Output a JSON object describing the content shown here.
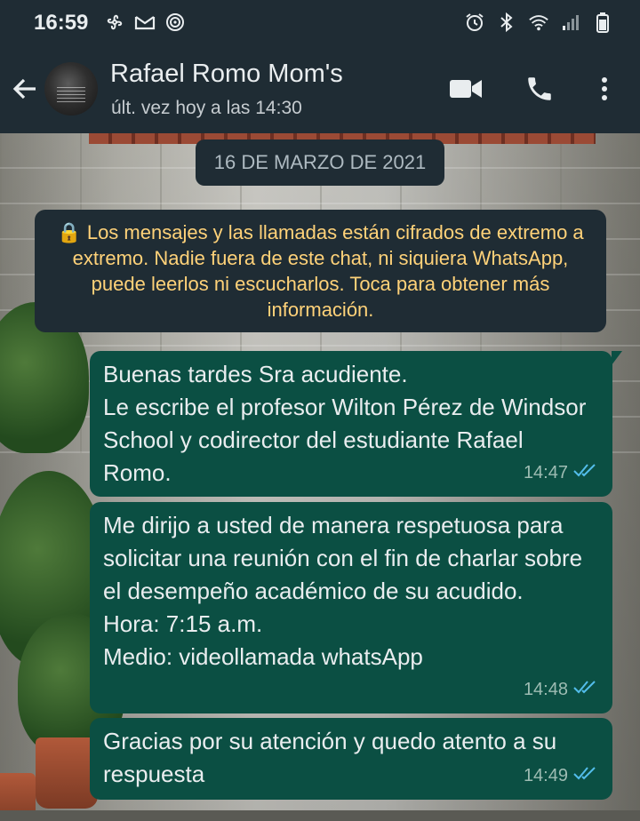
{
  "status_bar": {
    "time": "16:59",
    "left_icons": [
      "fan-icon",
      "gmail-icon",
      "target-icon"
    ],
    "right_icons": [
      "alarm-icon",
      "bluetooth-icon",
      "wifi-icon",
      "signal-icon",
      "battery-icon"
    ]
  },
  "header": {
    "chat_name": "Rafael Romo Mom's",
    "last_seen": "últ. vez hoy a las 14:30",
    "icons": [
      "back-arrow-icon",
      "video-call-icon",
      "phone-call-icon",
      "more-options-icon"
    ]
  },
  "chat": {
    "date_chip": "16 DE MARZO DE 2021",
    "encryption_notice": "🔒 Los mensajes y las llamadas están cifrados de extremo a extremo. Nadie fuera de este chat, ni siquiera WhatsApp, puede leerlos ni escucharlos. Toca para obtener más información.",
    "messages": [
      {
        "text": "Buenas tardes Sra acudiente.\nLe escribe el profesor Wilton Pérez de Windsor School y codirector del estudiante Rafael Romo.",
        "time": "14:47",
        "status": "read"
      },
      {
        "text": "Me dirijo a usted de manera respetuosa para solicitar una reunión con el fin de charlar sobre el desempeño académico de su acudido.\nHora: 7:15 a.m.\nMedio: videollamada whatsApp",
        "time": "14:48",
        "status": "read"
      },
      {
        "text": "Gracias por su atención y quedo atento a su respuesta",
        "time": "14:49",
        "status": "read"
      }
    ]
  },
  "colors": {
    "header_bg": "#1f2c34",
    "outgoing_bubble": "#0b4f43",
    "read_ticks": "#53bdeb",
    "notice_text": "#ffd279"
  }
}
